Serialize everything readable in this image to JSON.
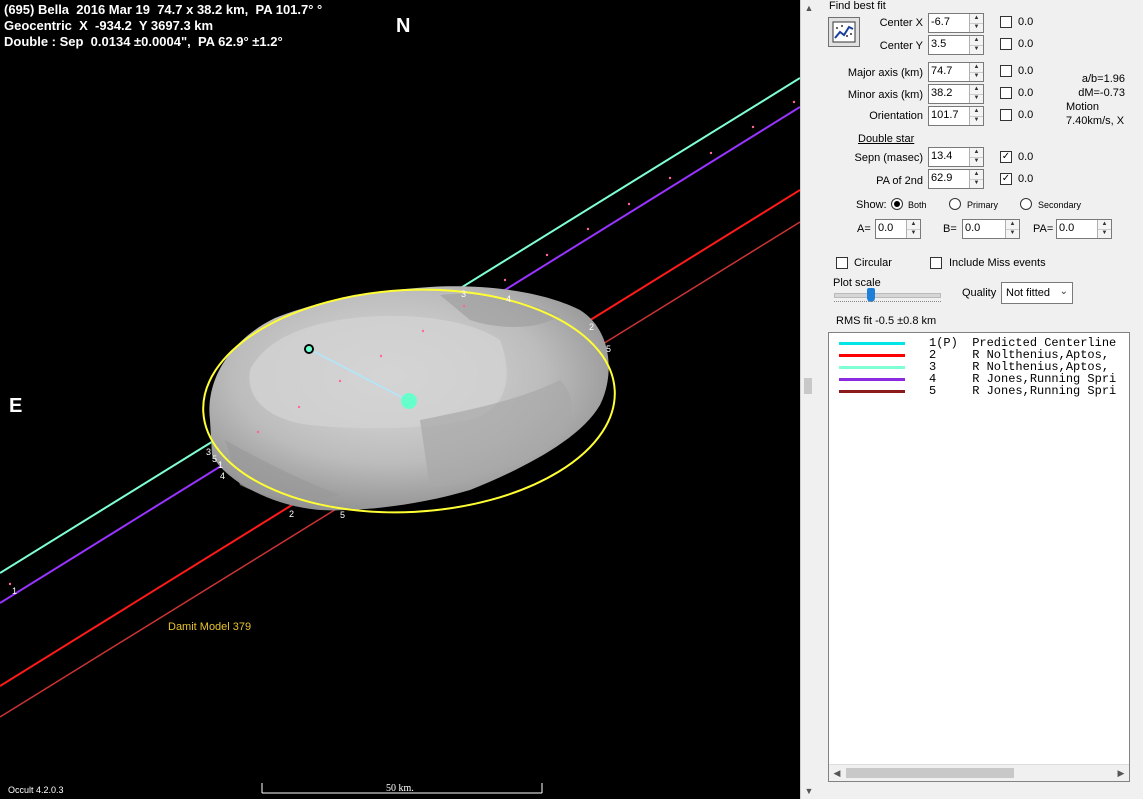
{
  "plot": {
    "header_line1": "(695) Bella  2016 Mar 19  74.7 x 38.2 km,  PA 101.7° °",
    "header_line2": "Geocentric  X  -934.2  Y 3697.3 km",
    "header_line3": "Double : Sep  0.0134 ±0.0004\",  PA 62.9° ±1.2°",
    "north_label": "N",
    "east_label": "E",
    "model_label": "Damit Model 379",
    "version": "Occult 4.2.0.3",
    "scale_label": "50 km.",
    "chord_labels": [
      "3",
      "4",
      "2",
      "5",
      "2",
      "5",
      "1",
      "1",
      "3",
      "4",
      "5"
    ],
    "colors": {
      "ellipse": "#ffff33",
      "predicted": "#7fffd4",
      "chord_red": "#ff1a1a",
      "chord_darkred": "#cc3333",
      "chord_purple": "#9933ff",
      "secondary_marker": "#66ffcc"
    }
  },
  "panel": {
    "find_best_fit": "Find best fit",
    "center_x": {
      "label": "Center X",
      "value": "-6.7",
      "check_value": "0.0",
      "checked": false
    },
    "center_y": {
      "label": "Center Y",
      "value": "3.5",
      "check_value": "0.0",
      "checked": false
    },
    "major_axis": {
      "label": "Major axis (km)",
      "value": "74.7",
      "check_value": "0.0",
      "checked": false
    },
    "minor_axis": {
      "label": "Minor axis (km)",
      "value": "38.2",
      "check_value": "0.0",
      "checked": false
    },
    "orientation": {
      "label": "Orientation",
      "value": "101.7",
      "check_value": "0.0",
      "checked": false
    },
    "ab_ratio": "a/b=1.96",
    "dm": "dM=-0.73",
    "motion_label": "Motion",
    "motion_value": "7.40km/s, X",
    "double_star": "Double star",
    "sepn": {
      "label": "Sepn (masec)",
      "value": "13.4",
      "check_value": "0.0",
      "checked": true
    },
    "pa2nd": {
      "label": "PA of 2nd",
      "value": "62.9",
      "check_value": "0.0",
      "checked": true
    },
    "show_label": "Show:",
    "show_options": [
      "Both",
      "Primary",
      "Secondary"
    ],
    "show_selected": "Both",
    "a_label": "A=",
    "a_value": "0.0",
    "b_label": "B=",
    "b_value": "0.0",
    "pa_label": "PA=",
    "pa_value": "0.0",
    "circular": "Circular",
    "include_miss": "Include Miss events",
    "plot_scale": "Plot scale",
    "quality_label": "Quality",
    "quality_value": "Not fitted",
    "rms_fit": "RMS fit -0.5 ±0.8 km",
    "legend": [
      {
        "text": "1(P)  Predicted Centerline",
        "color": "#00e5e5"
      },
      {
        "text": "2     R Nolthenius,Aptos,",
        "color": "#ff0000"
      },
      {
        "text": "3     R Nolthenius,Aptos,",
        "color": "#7fffd4"
      },
      {
        "text": "4     R Jones,Running Spri",
        "color": "#8a2be2"
      },
      {
        "text": "5     R Jones,Running Spri",
        "color": "#8b1a1a"
      }
    ]
  }
}
